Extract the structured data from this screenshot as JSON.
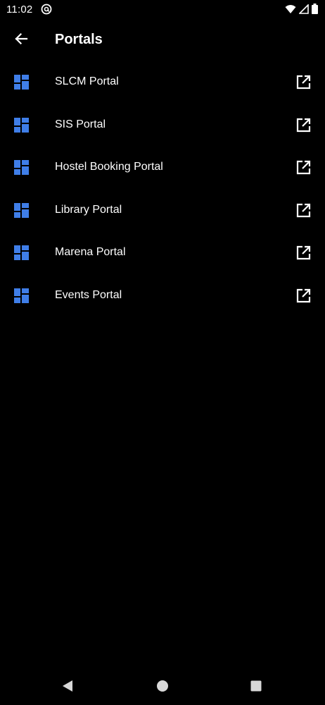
{
  "status_bar": {
    "time": "11:02",
    "app_icon": "at-sign-icon",
    "icons": [
      "wifi-icon",
      "signal-icon",
      "battery-icon"
    ]
  },
  "app_bar": {
    "title": "Portals",
    "back_icon": "arrow-back-icon"
  },
  "colors": {
    "background": "#000000",
    "accent": "#3f7ee8",
    "text": "#ffffff"
  },
  "portals": [
    {
      "label": "SLCM Portal",
      "icon": "dashboard-icon",
      "action_icon": "open-in-new-icon"
    },
    {
      "label": "SIS Portal",
      "icon": "dashboard-icon",
      "action_icon": "open-in-new-icon"
    },
    {
      "label": "Hostel Booking Portal",
      "icon": "dashboard-icon",
      "action_icon": "open-in-new-icon"
    },
    {
      "label": "Library Portal",
      "icon": "dashboard-icon",
      "action_icon": "open-in-new-icon"
    },
    {
      "label": "Marena Portal",
      "icon": "dashboard-icon",
      "action_icon": "open-in-new-icon"
    },
    {
      "label": "Events Portal",
      "icon": "dashboard-icon",
      "action_icon": "open-in-new-icon"
    }
  ],
  "nav_bar": {
    "icons": [
      "nav-back-icon",
      "nav-home-icon",
      "nav-recents-icon"
    ]
  }
}
